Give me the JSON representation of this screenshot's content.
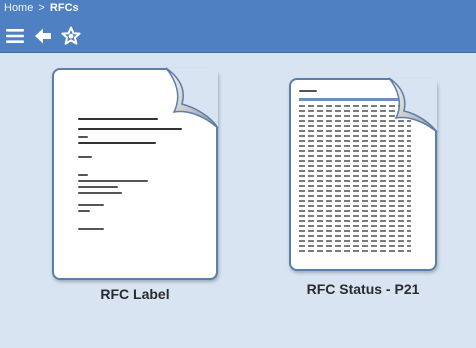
{
  "breadcrumb": {
    "home": "Home",
    "separator": ">",
    "current": "RFCs"
  },
  "toolbar": {
    "menu_icon": "hamburger-menu-icon",
    "back_icon": "back-arrow-icon",
    "favorite_icon": "star-favorite-icon"
  },
  "tiles": [
    {
      "label": "RFC Label",
      "icon": "document-icon"
    },
    {
      "label": "RFC Status - P21",
      "icon": "document-icon"
    }
  ],
  "colors": {
    "header": "#4f80c2",
    "background": "#d8e4f2",
    "document_border": "#5a7fa8"
  }
}
